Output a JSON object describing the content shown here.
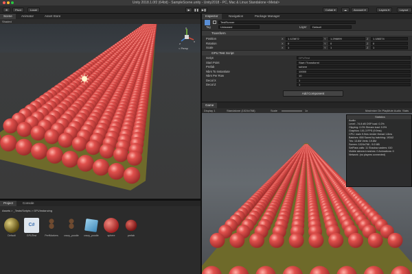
{
  "window": {
    "title": "Unity 2018.1.0f2 (64bit) - SampleScene.unity - Unity2018 - PC, Mac & Linux Standalone <Metal>"
  },
  "toolbar": {
    "left_buttons": [
      "⊕",
      "Pivot",
      "Local"
    ],
    "right_buttons": [
      "Collab ▾",
      "☁",
      "Account ▾",
      "Layers ▾",
      "Layout"
    ]
  },
  "scene_tabs": [
    "Scene",
    "Animator",
    "Asset Store"
  ],
  "scene_view": {
    "toolbar_text": "Shaded",
    "projection_label": "< Persp",
    "gizmo_labels": [
      "y",
      "x",
      "z"
    ]
  },
  "inspector": {
    "tabs": [
      "Inspector",
      "Navigation",
      "Package Manager"
    ],
    "object_name": "TestRunner",
    "tag_label": "Tag",
    "tag_value": "Untagged",
    "layer_label": "Layer",
    "layer_value": "Default",
    "transform": {
      "header": "Transform",
      "rows": [
        {
          "label": "Position",
          "x": "1.123872",
          "y": "1.296899",
          "z": "1.188374"
        },
        {
          "label": "Rotation",
          "x": "0",
          "y": "0",
          "z": "0"
        },
        {
          "label": "Scale",
          "x": "1",
          "y": "1",
          "z": "1"
        }
      ]
    },
    "script": {
      "header": "GPU Test Script",
      "rows": [
        {
          "label": "Script",
          "value": "GPUTest"
        },
        {
          "label": "Start Point",
          "value": "Start (Transform)"
        },
        {
          "label": "Prefab",
          "value": "sphere"
        },
        {
          "label": "Nbrs To Instantiate",
          "value": "10000"
        },
        {
          "label": "Nbrs Per Row",
          "value": "10"
        },
        {
          "label": "Decal X",
          "value": "1"
        },
        {
          "label": "Decal Z",
          "value": "1"
        }
      ]
    },
    "add_component": "Add Component"
  },
  "game_view": {
    "tabs": [
      "Game"
    ],
    "display": "Display 1",
    "aspect": "Standalone (1024x768)",
    "scale_label": "Scale",
    "scale_value": "1x",
    "right_options": [
      "Maximize On Play",
      "Mute Audio",
      "Stats",
      "Gizmos ▾"
    ]
  },
  "stats": {
    "title": "Statistics",
    "lines": [
      "Audio:",
      "Level: -74.8 dB        DSP load: 0.2%",
      "Clipping: 0.0%         Stream load: 0.0%",
      "Graphics:                        101.3 FPS (9.9ms)",
      "CPU: main 9.9ms  render thread 1.8ms",
      "Batches: 658     Saved by batching: 19342",
      "Tris: 13.8M      Verts: 19.8M",
      "Screen: 1024x768 - 9.0 MB",
      "SetPass calls: 11   Shadow casters: 610",
      "Visible skinned meshes: 0  Animations: 0",
      "Network: (no players connected)"
    ]
  },
  "project": {
    "tabs": [
      "Project",
      "Console"
    ],
    "path": "Assets > _Tests/Scripts > GPUInstancing",
    "assets": [
      {
        "label": "Default",
        "kind": "material-dark"
      },
      {
        "label": "GPUTest",
        "kind": "csharp-script"
      },
      {
        "label": "PerfMarkers",
        "kind": "figure"
      },
      {
        "label": "crazy_poodle",
        "kind": "figure"
      },
      {
        "label": "crazy_poodle",
        "kind": "cube"
      },
      {
        "label": "sphere",
        "kind": "material-red"
      },
      {
        "label": "prefab",
        "kind": "material-red-small"
      }
    ]
  },
  "colors": {
    "sphere": "#e0504c",
    "sphere_shadow": "#9a2c2a",
    "ground": "#6e6a2a",
    "accent": "#3d7ec5"
  }
}
